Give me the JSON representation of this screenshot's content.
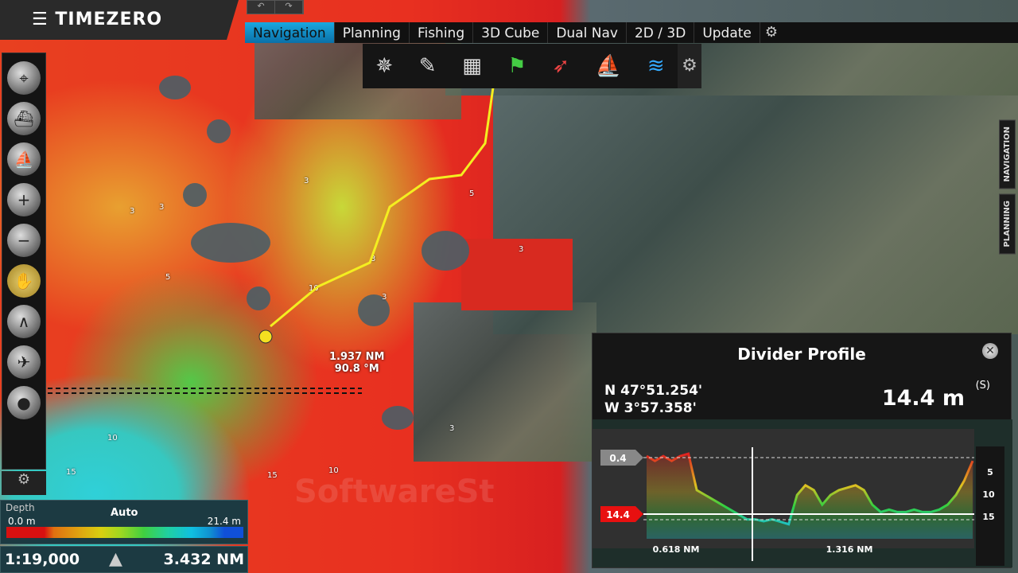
{
  "app": {
    "title": "TIMEZERO",
    "menu_icon": "hamburger-icon"
  },
  "undo_redo": {
    "undo": "↶",
    "redo": "↷"
  },
  "tabs": [
    {
      "label": "Navigation",
      "active": true
    },
    {
      "label": "Planning"
    },
    {
      "label": "Fishing"
    },
    {
      "label": "3D Cube"
    },
    {
      "label": "Dual Nav"
    },
    {
      "label": "2D / 3D"
    },
    {
      "label": "Update"
    }
  ],
  "toolbar": [
    {
      "icon": "compass-rose-icon",
      "glyph": "✵"
    },
    {
      "icon": "chart-layers-icon",
      "glyph": "✎"
    },
    {
      "icon": "chart-frame-icon",
      "glyph": "▦"
    },
    {
      "icon": "route-icon",
      "glyph": "⚑"
    },
    {
      "icon": "boat-icon",
      "glyph": "➶"
    },
    {
      "icon": "tide-icon",
      "glyph": "⛵"
    },
    {
      "icon": "sounder-icon",
      "glyph": "≋"
    }
  ],
  "left_tools": [
    {
      "icon": "head-up-icon",
      "glyph": "⌖"
    },
    {
      "icon": "center-boat-icon",
      "glyph": "⛴"
    },
    {
      "icon": "boat-view-icon",
      "glyph": "⛵"
    },
    {
      "icon": "zoom-in-icon",
      "glyph": "+"
    },
    {
      "icon": "zoom-out-icon",
      "glyph": "−"
    },
    {
      "icon": "pan-hand-icon",
      "glyph": "✋"
    },
    {
      "icon": "divider-icon",
      "glyph": "∧"
    },
    {
      "icon": "measure-icon",
      "glyph": "✈"
    },
    {
      "icon": "mob-icon",
      "glyph": "●"
    }
  ],
  "side_tabs": [
    "NAVIGATION",
    "PLANNING"
  ],
  "depth_legend": {
    "title": "Depth",
    "mode": "Auto",
    "min": "0.0 m",
    "max": "21.4 m"
  },
  "scale": {
    "ratio": "1:19,000",
    "range": "3.432 NM"
  },
  "divider": {
    "distance": "1.937 NM",
    "bearing": "90.8 °M"
  },
  "depth_labels": [
    {
      "v": "3"
    },
    {
      "v": "3"
    },
    {
      "v": "5"
    },
    {
      "v": "3"
    },
    {
      "v": "10"
    },
    {
      "v": "3"
    },
    {
      "v": "3"
    },
    {
      "v": "10"
    },
    {
      "v": "15"
    },
    {
      "v": "10"
    },
    {
      "v": "15"
    },
    {
      "v": "5"
    },
    {
      "v": "3"
    },
    {
      "v": "3"
    }
  ],
  "watermark": "SoftwareSt",
  "profile_panel": {
    "title": "Divider Profile",
    "lat": "N 47°51.254'",
    "lon": "W 3°57.358'",
    "depth": "14.4 m",
    "depth_unit": "(S)",
    "top_marker": "0.4",
    "bottom_marker": "14.4",
    "left_distance": "0.618 NM",
    "right_distance": "1.316 NM",
    "axis_ticks": [
      "5",
      "10",
      "15"
    ],
    "depths_m": [
      1,
      2,
      1,
      2,
      1,
      0.5,
      8,
      9,
      10,
      11,
      12,
      13,
      14,
      14,
      14.4,
      14,
      14.5,
      15,
      9,
      7,
      8,
      11,
      9,
      8,
      7.5,
      7,
      8,
      11,
      12.5,
      12,
      12.5,
      12.5,
      12,
      12.5,
      12.5,
      12,
      11,
      9,
      6,
      2
    ],
    "axis_max": 18
  }
}
